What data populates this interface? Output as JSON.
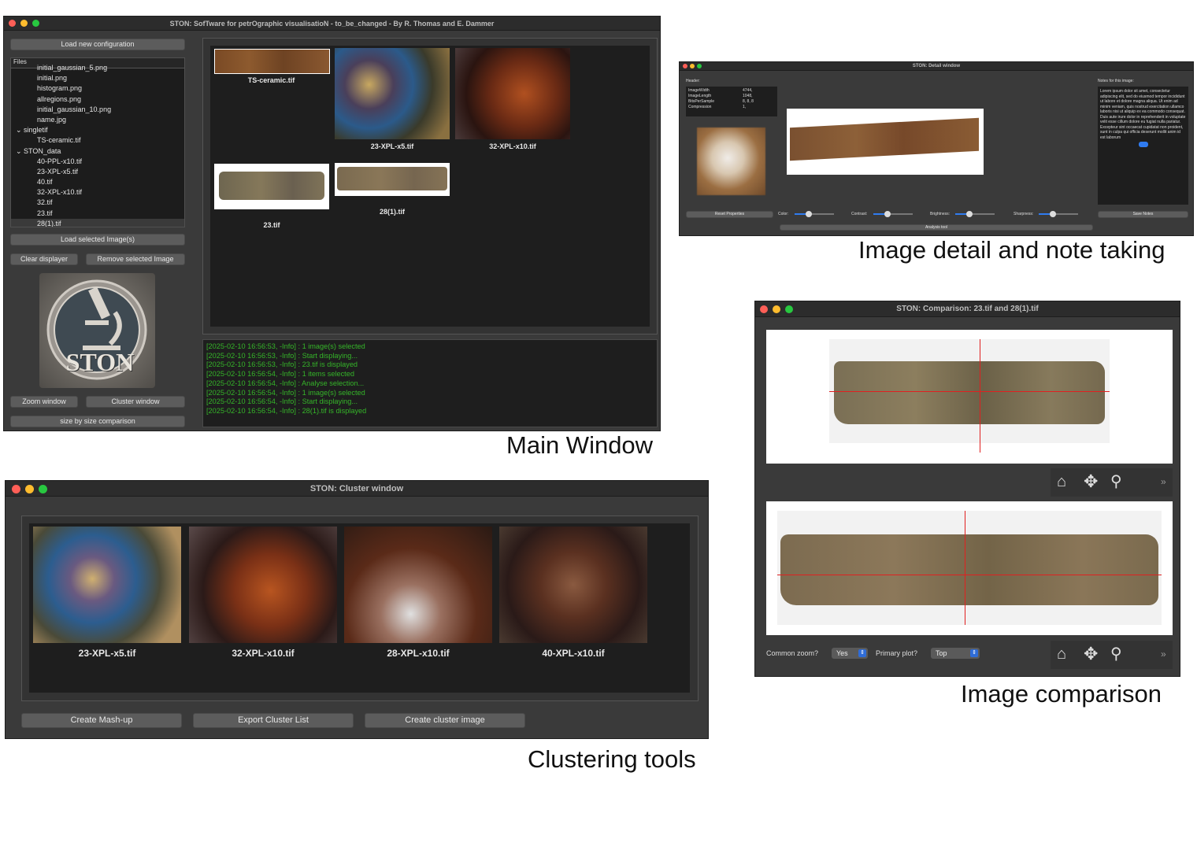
{
  "main_window": {
    "title": "STON: SofTware for petrOgraphic visualisatioN - to_be_changed - By R. Thomas and E. Dammer",
    "load_config_label": "Load new configuration",
    "files_header": "Files",
    "file_tree": [
      {
        "label": "initial_gaussian_5.png",
        "indent": 2
      },
      {
        "label": "initial.png",
        "indent": 2
      },
      {
        "label": "histogram.png",
        "indent": 2
      },
      {
        "label": "allregions.png",
        "indent": 2
      },
      {
        "label": "initial_gaussian_10.png",
        "indent": 2
      },
      {
        "label": "name.jpg",
        "indent": 2
      },
      {
        "label": "singletif",
        "indent": 1,
        "folder": true
      },
      {
        "label": "TS-ceramic.tif",
        "indent": 2
      },
      {
        "label": "STON_data",
        "indent": 1,
        "folder": true
      },
      {
        "label": "40-PPL-x10.tif",
        "indent": 2
      },
      {
        "label": "23-XPL-x5.tif",
        "indent": 2
      },
      {
        "label": "40.tif",
        "indent": 2
      },
      {
        "label": "32-XPL-x10.tif",
        "indent": 2
      },
      {
        "label": "32.tif",
        "indent": 2
      },
      {
        "label": "23.tif",
        "indent": 2
      },
      {
        "label": "28(1).tif",
        "indent": 2,
        "selected": true
      }
    ],
    "load_selected_label": "Load selected Image(s)",
    "clear_label": "Clear displayer",
    "remove_label": "Remove selected Image",
    "logo_text": "STON",
    "zoom_label": "Zoom window",
    "cluster_label": "Cluster window",
    "size_label": "size by size comparison",
    "thumbnails": [
      {
        "label": "TS-ceramic.tif"
      },
      {
        "label": "23-XPL-x5.tif"
      },
      {
        "label": "32-XPL-x10.tif"
      },
      {
        "label": "23.tif"
      },
      {
        "label": "28(1).tif"
      }
    ],
    "log": [
      "[2025-02-10 16:56:53, -Info] : 1 image(s) selected",
      "[2025-02-10 16:56:53, -Info] : Start displaying...",
      "[2025-02-10 16:56:53, -Info] : 23.tif is displayed",
      "[2025-02-10 16:56:54, -Info] : 1 items selected",
      "[2025-02-10 16:56:54, -Info] : Analyse selection...",
      "[2025-02-10 16:56:54, -Info] : 1 image(s) selected",
      "[2025-02-10 16:56:54, -Info] : Start displaying...",
      "[2025-02-10 16:56:54, -Info] : 28(1).tif is displayed"
    ],
    "caption": "Main Window"
  },
  "detail_window": {
    "title": "STON: Detail window",
    "header_label": "Header:",
    "header_keys": [
      "ImageWidth",
      "ImageLength",
      "BitsPerSample",
      "Compression"
    ],
    "header_values": [
      "4744,",
      "1048,",
      "8, 8, 8",
      "1,"
    ],
    "notes_label": "Notes for this image:",
    "notes_text": "Lorem ipsum dolor sit amet, consectetur adipiscing elit, sed do eiusmod tempor incididunt ut labore et dolore magna aliqua. Ut enim ad minim veniam, quis nostrud exercitation ullamco laboris nisi ut aliquip ex ea commodo consequat. Duis aute irure dolor in reprehenderit in voluptate velit esse cillum dolore eu fugiat nulla pariatur. Excepteur sint occaecat cupidatat non proident, sunt in culpa qui officia deserunt mollit anim id est laborum",
    "reset_label": "Reset Properties",
    "color_label": "Color:",
    "contrast_label": "Contrast:",
    "brightness_label": "Brightness:",
    "sharpness_label": "Sharpness:",
    "save_label": "Save Notes",
    "analysis_label": "Analysis tool",
    "caption": "Image detail and note taking"
  },
  "comparison_window": {
    "title": "STON: Comparison: 23.tif and 28(1).tif",
    "common_zoom_label": "Common zoom?",
    "common_zoom_value": "Yes",
    "primary_plot_label": "Primary plot?",
    "primary_plot_value": "Top",
    "more_glyph": "»",
    "caption": "Image comparison"
  },
  "cluster_window": {
    "title": "STON: Cluster window",
    "images": [
      {
        "label": "23-XPL-x5.tif"
      },
      {
        "label": "32-XPL-x10.tif"
      },
      {
        "label": "28-XPL-x10.tif"
      },
      {
        "label": "40-XPL-x10.tif"
      }
    ],
    "mashup_label": "Create Mash-up",
    "export_label": "Export Cluster List",
    "create_image_label": "Create cluster image",
    "caption": "Clustering tools"
  },
  "colors": {
    "log_green": "#35b529",
    "crosshair_red": "#e02020",
    "slider_blue": "#2f7bf0"
  }
}
